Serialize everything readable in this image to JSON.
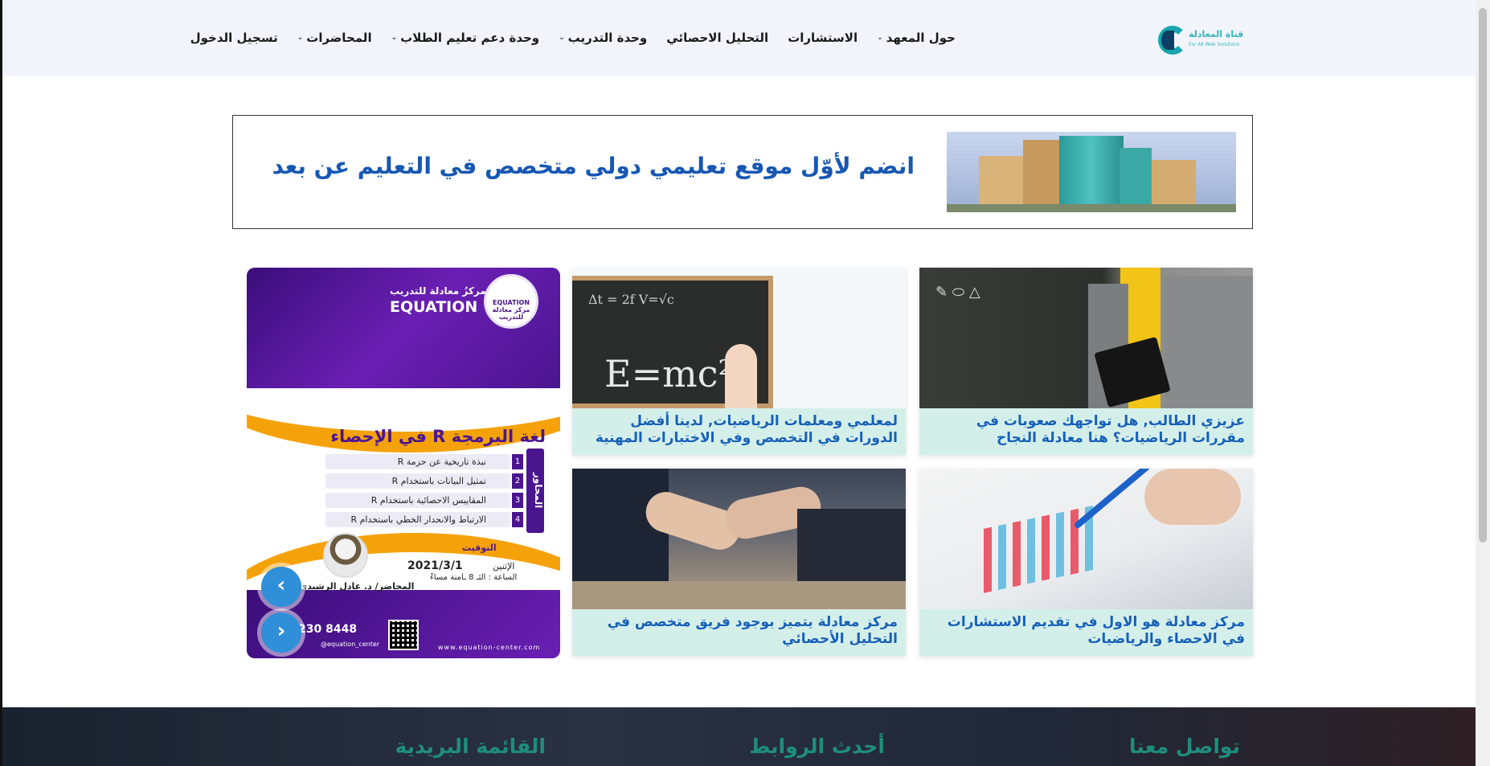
{
  "logo": {
    "line1": "قناة المعادلة",
    "line2": "For All Web Solutions"
  },
  "nav": [
    {
      "label": "حول المعهد",
      "dropdown": true
    },
    {
      "label": "الاستشارات",
      "dropdown": false
    },
    {
      "label": "التحليل الاحصائي",
      "dropdown": false
    },
    {
      "label": "وحدة التدريب",
      "dropdown": true
    },
    {
      "label": "وحدة دعم تعليم الطلاب",
      "dropdown": true
    },
    {
      "label": "المحاضرات",
      "dropdown": true
    },
    {
      "label": "تسجيل الدخول",
      "dropdown": false
    }
  ],
  "banner": {
    "title": "انضم لأوّل موقع تعليمي دولي متخصص في التعليم عن بعد"
  },
  "cards": [
    {
      "title": "عزيزي الطالب, هل تواجهك صعوبات في مقررات الرياضيات؟ هنا معادلة النجاح"
    },
    {
      "title": "لمعلمي ومعلمات الرياضيات, لدينا أفضل الدورات في التخصص وفي الاختبارات المهنية"
    },
    {
      "title": "مركز معادلة هو الاول في تقديم الاستشارات في الاحصاء والرياضيات"
    },
    {
      "title": "مركز معادلة يتميز بوجود فريق متخصص في التحليل الأحصائي"
    }
  ],
  "poster": {
    "logo_text": "EQUATION مركز معادلة للتدريب",
    "brand_ar": "مركزُ معادلة للتدريب",
    "brand_en": "EQUATION",
    "heading": "لغة البرمجة R في الإحصاء",
    "axis_label": "المحاور",
    "topics": [
      {
        "num": "1",
        "text": "نبذة تاريخية عن حزمة R"
      },
      {
        "num": "2",
        "text": "تمثيل البيانات باستخدام R"
      },
      {
        "num": "3",
        "text": "المقاييس الاحصائية باستخدام R"
      },
      {
        "num": "4",
        "text": "الارتباط والانحدار الخطي باستخدام R"
      }
    ],
    "timing_label": "التوقيت",
    "day": "الإثنين",
    "date": "2021/3/1",
    "time": "الساعة : الثـ 8 ـامنة مساءً",
    "lecturer": "المحاضر/ د. عادل الرشيدي",
    "phone": "230 8448",
    "handle": "@equation_center",
    "website": "www.equation-center.com"
  },
  "slider": {
    "next": "›",
    "prev": "‹"
  },
  "footer": {
    "headings": [
      "تواصل معنا",
      "أحدث الروابط",
      "القائمة البريدية"
    ]
  }
}
